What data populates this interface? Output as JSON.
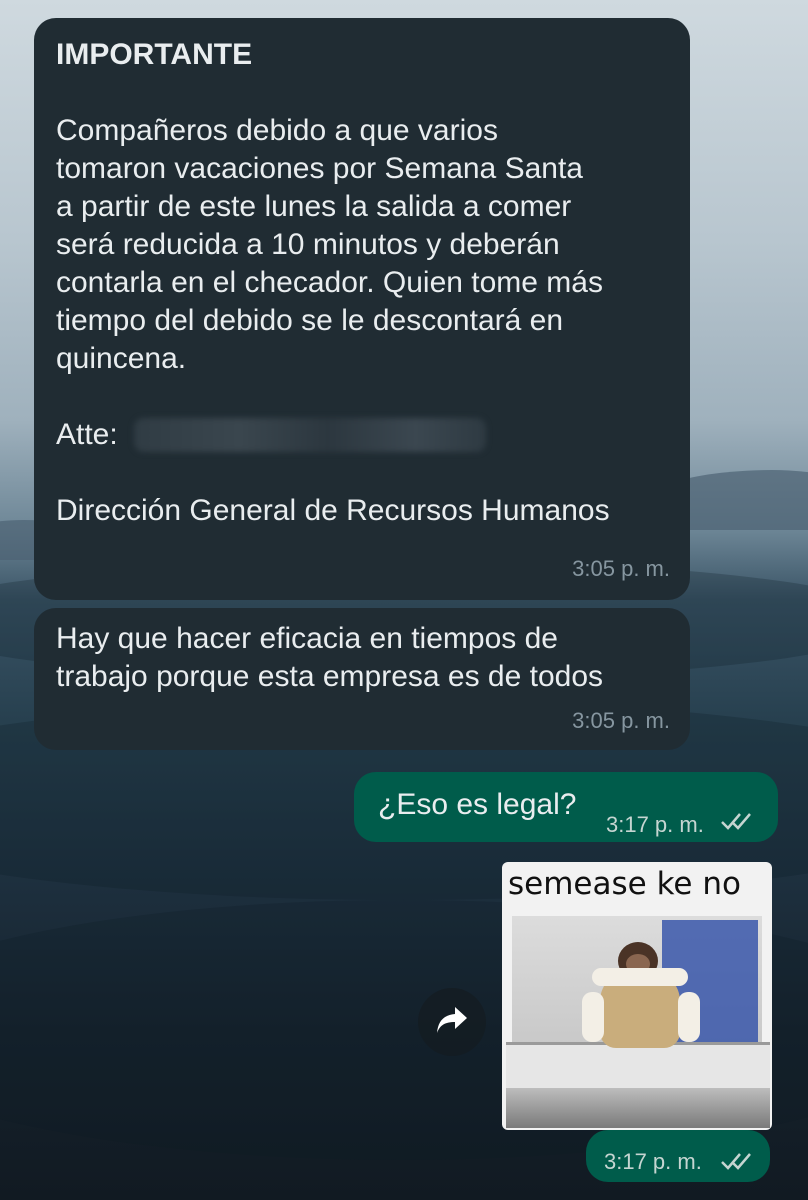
{
  "messages": {
    "m1": {
      "title": "IMPORTANTE",
      "body": "Compañeros debido a que varios\ntomaron vacaciones por Semana Santa\na partir de este lunes la salida a comer\nserá reducida a 10 minutos y deberán\ncontarla en el checador. Quien tome más\ntiempo del debido se le descontará en\nquincena.",
      "atte": "Atte:",
      "department": "Dirección General de Recursos Humanos",
      "time": "3:05 p. m."
    },
    "m2": {
      "body": "Hay que hacer eficacia en tiempos de\ntrabajo porque esta empresa es de todos",
      "time": "3:05 p. m."
    },
    "m3": {
      "body": "¿Eso es legal?",
      "time": "3:17 p. m.",
      "ticks": "//"
    },
    "m4": {
      "caption": "semease ke no",
      "time": "3:17 p. m.",
      "ticks": "//"
    }
  },
  "icons": {
    "forward": "forward-arrow-icon",
    "read_receipt": "double-check-icon"
  },
  "colors": {
    "incoming_bubble": "#202c33",
    "outgoing_bubble": "#005c4b",
    "text": "#e9edef",
    "timestamp": "#8696a0"
  }
}
